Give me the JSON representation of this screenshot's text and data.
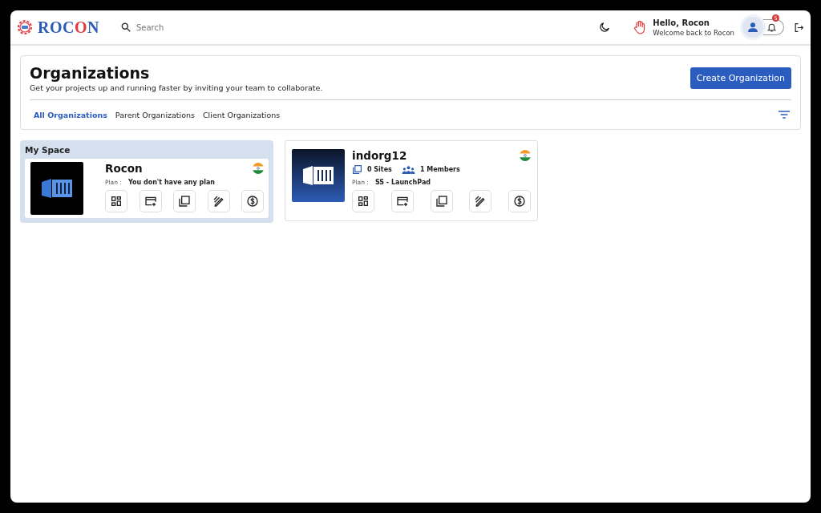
{
  "header": {
    "logo": [
      {
        "text": "ROC",
        "color": "#2b5cb8"
      },
      {
        "text": "O",
        "color": "#e0393e"
      },
      {
        "text": "N",
        "color": "#2b5cb8"
      }
    ],
    "search": {
      "placeholder": "Search"
    },
    "greeting": "Hello, Rocon",
    "subtitle": "Welcome back to Rocon",
    "notification_count": "5"
  },
  "page": {
    "title": "Organizations",
    "description": "Get your projects up and running faster by inviting your team to collaborate.",
    "create_button": "Create Organization",
    "tabs": [
      {
        "label": "All Organizations",
        "selected": true
      },
      {
        "label": "Parent Organizations",
        "selected": false
      },
      {
        "label": "Client Organizations",
        "selected": false
      }
    ]
  },
  "organizations": [
    {
      "kind": "my_space",
      "section_title": "My Space",
      "name": "Rocon",
      "plan_label": "Plan :",
      "plan": "You don't have any plan"
    },
    {
      "kind": "org",
      "name": "indorg12",
      "sites": "0 Sites",
      "members": "1 Members",
      "plan_label": "Plan :",
      "plan": "SS - LaunchPad"
    }
  ]
}
